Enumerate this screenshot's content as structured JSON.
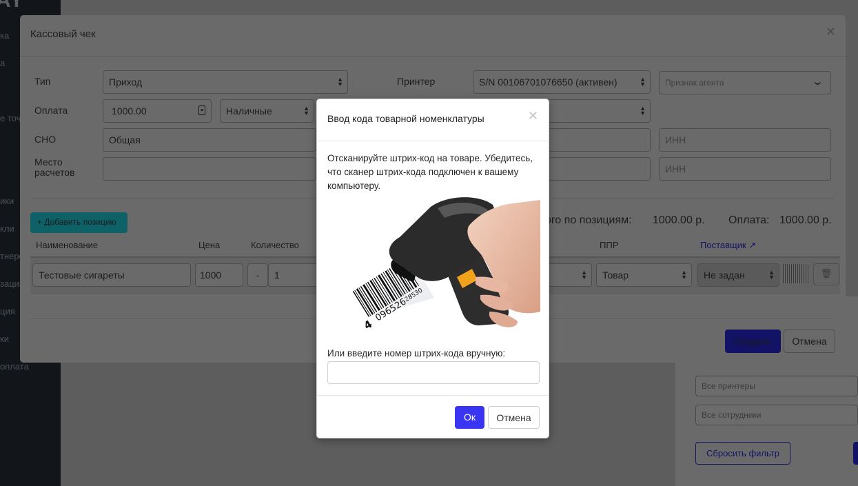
{
  "background": {
    "logo_text": "AY",
    "sidebar_items": [
      "ка",
      "а",
      "е точ",
      "ики",
      "кли",
      "тнеро",
      "зации",
      "ция",
      "ки",
      "оплата"
    ],
    "filter": {
      "printers_placeholder": "Все принтеры",
      "employees_placeholder": "Все сотрудники",
      "reset_label": "Сбросить фильтр"
    }
  },
  "receipt_modal": {
    "title": "Кассовый чек",
    "close_icon": "close-icon",
    "fields": {
      "type_label": "Тип",
      "type_value": "Приход",
      "payment_label": "Оплата",
      "payment_amount": "1000.00",
      "payment_method": "Наличные",
      "tax_label": "СНО",
      "tax_value": "Общая",
      "place_label": "Место расчетов",
      "printer_label": "Принтер",
      "printer_value": "S/N 00106701076650 (активен)",
      "agent_placeholder": "Признак агента",
      "inn_placeholder_1": "ИНН",
      "inn_placeholder_2": "ИНН"
    },
    "add_position_label": "+ Добавить позицию",
    "totals": {
      "positions_label": "ого по позициям:",
      "positions_value": "1000.00 р.",
      "payment_label": "Оплата:",
      "payment_value": "1000.00 р."
    },
    "table": {
      "headers": {
        "name": "Наименование",
        "price": "Цена",
        "quantity": "Количество",
        "ppr": "ППР",
        "supplier": "Поставщик"
      },
      "row": {
        "name": "Тестовые сигареты",
        "price": "1000",
        "qty_minus": "-",
        "qty": "1",
        "ppr": "Товар",
        "supplier": "Не задан"
      }
    },
    "create_label": "Создать",
    "cancel_label": "Отмена"
  },
  "barcode_dialog": {
    "title": "Ввод кода товарной номенклатуры",
    "instructions": "Отсканируйте штрих-код на товаре. Убедитесь, что сканер штрих-кода подключен к вашему компьютеру.",
    "barcode_digits_a": "4",
    "barcode_digits_b": "096526",
    "barcode_digits_c": "28530",
    "manual_label": "Или введите номер штрих-кода вручную:",
    "manual_value": "",
    "ok_label": "Ок",
    "cancel_label": "Отмена",
    "colors": {
      "primary": "#3a35f2",
      "scanner_trigger": "#f3a21b"
    }
  }
}
